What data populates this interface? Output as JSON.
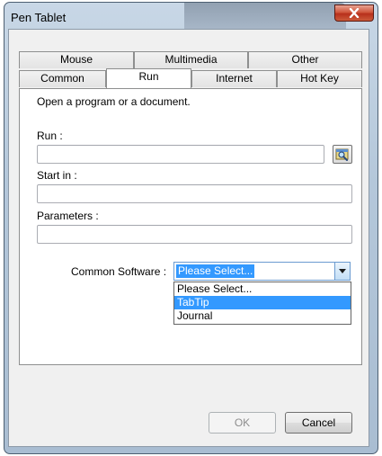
{
  "window": {
    "title": "Pen Tablet",
    "close_label": "x"
  },
  "tabs": {
    "row_back": [
      {
        "label": "Mouse"
      },
      {
        "label": "Multimedia"
      },
      {
        "label": "Other"
      }
    ],
    "row_front": [
      {
        "label": "Common"
      },
      {
        "label": "Run"
      },
      {
        "label": "Internet"
      },
      {
        "label": "Hot Key"
      }
    ],
    "active": "Run"
  },
  "run_panel": {
    "description": "Open a program or a document.",
    "run_label": "Run :",
    "run_value": "",
    "start_in_label": "Start in :",
    "start_in_value": "",
    "parameters_label": "Parameters :",
    "parameters_value": "",
    "common_software_label": "Common Software :",
    "common_software_selected": "Please Select...",
    "common_software_options": [
      "Please Select...",
      "TabTip",
      "Journal"
    ],
    "highlighted_option": "TabTip"
  },
  "buttons": {
    "ok": "OK",
    "cancel": "Cancel"
  },
  "colors": {
    "selection": "#3399ff",
    "close_button": "#c7432a"
  }
}
